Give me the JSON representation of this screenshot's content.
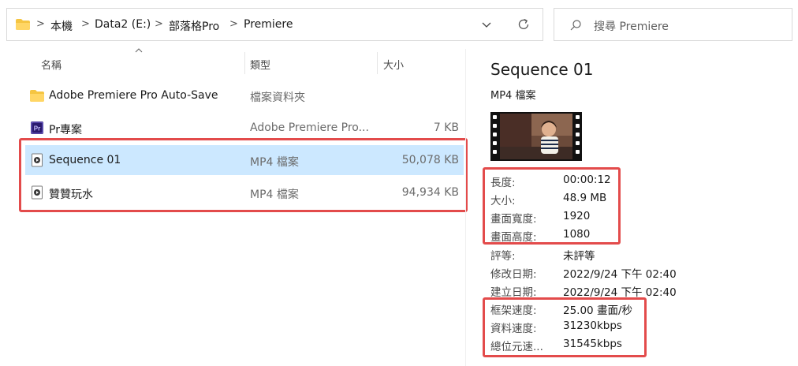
{
  "breadcrumbs": [
    "本機",
    "Data2 (E:)",
    "部落格Pro",
    "Premiere"
  ],
  "search": {
    "placeholder": "搜尋 Premiere"
  },
  "columns": {
    "name": "名稱",
    "type": "類型",
    "size": "大小"
  },
  "files": [
    {
      "name": "Adobe Premiere Pro Auto-Save",
      "type": "檔案資料夾",
      "size": "",
      "icon": "folder-icon"
    },
    {
      "name": "Pr專案",
      "type": "Adobe Premiere Pro...",
      "size": "7 KB",
      "icon": "premiere-project-icon"
    },
    {
      "name": "Sequence 01",
      "type": "MP4 檔案",
      "size": "50,078 KB",
      "icon": "video-file-icon",
      "selected": true
    },
    {
      "name": "贊贊玩水",
      "type": "MP4 檔案",
      "size": "94,934 KB",
      "icon": "video-file-icon"
    }
  ],
  "details": {
    "title": "Sequence 01",
    "type": "MP4 檔案",
    "thumbnail": "video-thumbnail",
    "properties": [
      {
        "key": "長度:",
        "value": "00:00:12"
      },
      {
        "key": "大小:",
        "value": "48.9 MB"
      },
      {
        "key": "畫面寬度:",
        "value": "1920"
      },
      {
        "key": "畫面高度:",
        "value": "1080"
      },
      {
        "key": "評等:",
        "value": "未評等"
      },
      {
        "key": "修改日期:",
        "value": "2022/9/24 下午 02:40"
      },
      {
        "key": "建立日期:",
        "value": "2022/9/24 下午 02:40"
      },
      {
        "key": "框架速度:",
        "value": "25.00 畫面/秒"
      },
      {
        "key": "資料速度:",
        "value": "31230kbps"
      },
      {
        "key": "總位元速...",
        "value": "31545kbps"
      }
    ]
  },
  "colors": {
    "selection": "#cce8ff",
    "highlight": "#e34b4b",
    "folder": "#f5c542",
    "premiere": "#2a1a6e"
  }
}
